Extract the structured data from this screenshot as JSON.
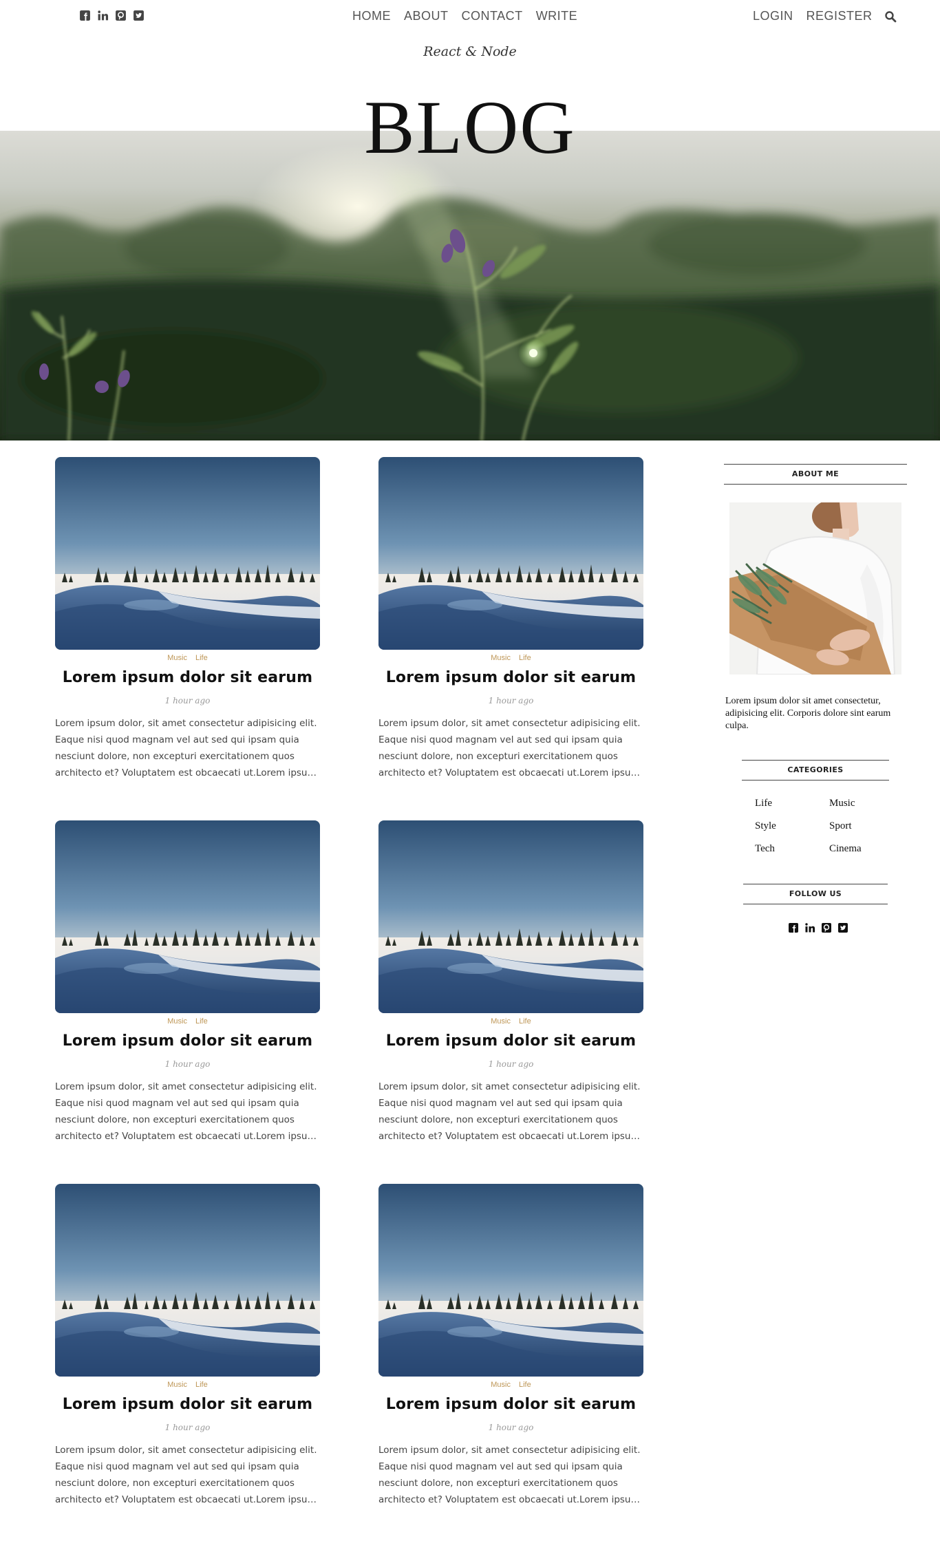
{
  "header": {
    "social": [
      "facebook-square-icon",
      "linkedin-icon",
      "pinterest-square-icon",
      "twitter-square-icon"
    ],
    "nav": [
      "HOME",
      "ABOUT",
      "CONTACT",
      "WRITE"
    ],
    "auth": [
      "LOGIN",
      "REGISTER"
    ],
    "search_icon": "search-icon",
    "tagline": "React & Node",
    "title": "BLOG"
  },
  "posts": [
    {
      "categories": [
        "Music",
        "Life"
      ],
      "title": "Lorem ipsum dolor sit earum",
      "date": "1 hour ago",
      "desc": "Lorem ipsum dolor, sit amet consectetur adipisicing elit. Eaque nisi quod magnam vel aut sed qui ipsam quia nesciunt dolore, non excepturi exercitationem quos architecto et? Voluptatem est obcaecati ut.Lorem ipsum dolor sit amet consectetur"
    },
    {
      "categories": [
        "Music",
        "Life"
      ],
      "title": "Lorem ipsum dolor sit earum",
      "date": "1 hour ago",
      "desc": "Lorem ipsum dolor, sit amet consectetur adipisicing elit. Eaque nisi quod magnam vel aut sed qui ipsam quia nesciunt dolore, non excepturi exercitationem quos architecto et? Voluptatem est obcaecati ut.Lorem ipsum dolor sit amet consectetur"
    },
    {
      "categories": [
        "Music",
        "Life"
      ],
      "title": "Lorem ipsum dolor sit earum",
      "date": "1 hour ago",
      "desc": "Lorem ipsum dolor, sit amet consectetur adipisicing elit. Eaque nisi quod magnam vel aut sed qui ipsam quia nesciunt dolore, non excepturi exercitationem quos architecto et? Voluptatem est obcaecati ut.Lorem ipsum dolor sit amet consectetur"
    },
    {
      "categories": [
        "Music",
        "Life"
      ],
      "title": "Lorem ipsum dolor sit earum",
      "date": "1 hour ago",
      "desc": "Lorem ipsum dolor, sit amet consectetur adipisicing elit. Eaque nisi quod magnam vel aut sed qui ipsam quia nesciunt dolore, non excepturi exercitationem quos architecto et? Voluptatem est obcaecati ut.Lorem ipsum dolor sit amet consectetur"
    },
    {
      "categories": [
        "Music",
        "Life"
      ],
      "title": "Lorem ipsum dolor sit earum",
      "date": "1 hour ago",
      "desc": "Lorem ipsum dolor, sit amet consectetur adipisicing elit. Eaque nisi quod magnam vel aut sed qui ipsam quia nesciunt dolore, non excepturi exercitationem quos architecto et? Voluptatem est obcaecati ut.Lorem ipsum dolor sit amet consectetur"
    },
    {
      "categories": [
        "Music",
        "Life"
      ],
      "title": "Lorem ipsum dolor sit earum",
      "date": "1 hour ago",
      "desc": "Lorem ipsum dolor, sit amet consectetur adipisicing elit. Eaque nisi quod magnam vel aut sed qui ipsam quia nesciunt dolore, non excepturi exercitationem quos architecto et? Voluptatem est obcaecati ut.Lorem ipsum dolor sit amet consectetur"
    }
  ],
  "sidebar": {
    "about_title": "ABOUT ME",
    "about_text": "Lorem ipsum dolor sit amet consectetur, adipisicing elit. Corporis dolore sint earum culpa.",
    "categories_title": "CATEGORIES",
    "categories": [
      "Life",
      "Music",
      "Style",
      "Sport",
      "Tech",
      "Cinema"
    ],
    "follow_title": "FOLLOW US",
    "social": [
      "facebook-square-icon",
      "linkedin-icon",
      "pinterest-square-icon",
      "twitter-square-icon"
    ]
  },
  "colors": {
    "category_accent": "#be9656",
    "text_dark": "#111111",
    "nav_text": "#555555"
  }
}
